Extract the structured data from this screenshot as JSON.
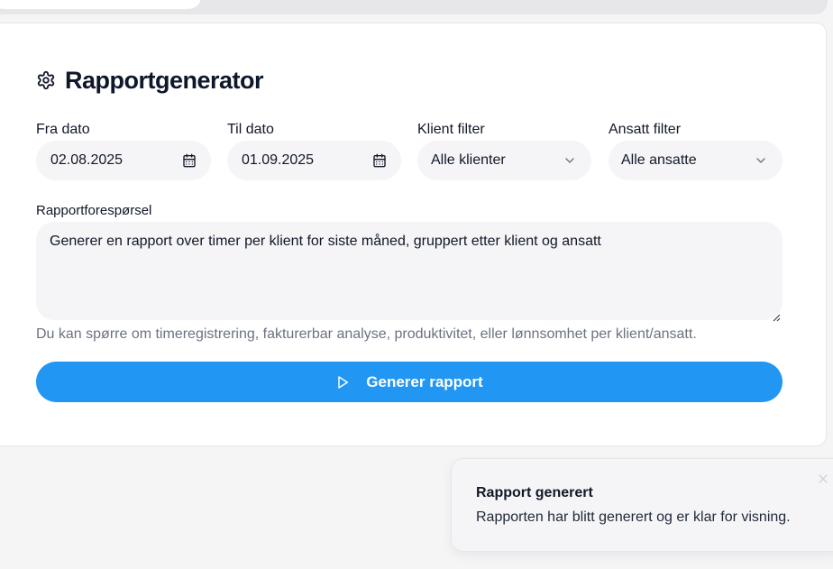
{
  "tabs": [
    {
      "label": "",
      "active": true
    },
    {
      "label": "",
      "active": false
    },
    {
      "label": "",
      "active": false
    }
  ],
  "report": {
    "title": "Rapportgenerator",
    "title_icon": "gear-icon",
    "from_date": {
      "label": "Fra dato",
      "value": "02.08.2025",
      "icon": "calendar-icon"
    },
    "to_date": {
      "label": "Til dato",
      "value": "01.09.2025",
      "icon": "calendar-icon"
    },
    "client_filter": {
      "label": "Klient filter",
      "value": "Alle klienter",
      "icon": "chevron-down-icon"
    },
    "employee_filter": {
      "label": "Ansatt filter",
      "value": "Alle ansatte",
      "icon": "chevron-down-icon"
    },
    "request": {
      "label": "Rapportforespørsel",
      "value": "Generer en rapport over timer per klient for siste måned, gruppert etter klient og ansatt"
    },
    "hint": "Du kan spørre om timeregistrering, fakturerbar analyse, produktivitet, eller lønnsomhet per klient/ansatt.",
    "generate_button": {
      "label": "Generer rapport",
      "icon": "play-icon"
    }
  },
  "toast": {
    "title": "Rapport generert",
    "description": "Rapporten har blitt generert og er klar for visning.",
    "close_icon": "close-icon"
  },
  "colors": {
    "accent": "#2196f3",
    "field_bg": "#f5f5f7",
    "page_bg": "#f5f5f6",
    "hint_text": "#6b7280"
  }
}
